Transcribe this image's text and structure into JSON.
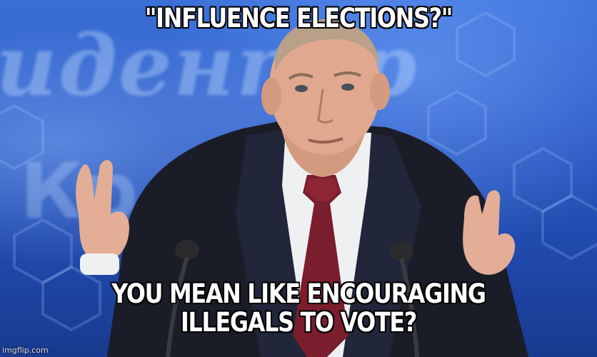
{
  "meme": {
    "top_caption": "\"INFLUENCE ELECTIONS?\"",
    "bottom_caption_line1": "YOU MEAN LIKE ENCOURAGING",
    "bottom_caption_line2": "ILLEGALS TO VOTE?",
    "watermark": "imgflip.com",
    "background_sign_text_1": "идент.р",
    "background_sign_text_2": "Кр"
  },
  "colors": {
    "backdrop_blue": "#2a58c2",
    "suit": "#1a1d28",
    "shirt": "#eef0f2",
    "tie": "#7a1d2c",
    "skin": "#e0a98f",
    "caption_text": "#ffffff",
    "caption_outline": "#000000"
  }
}
